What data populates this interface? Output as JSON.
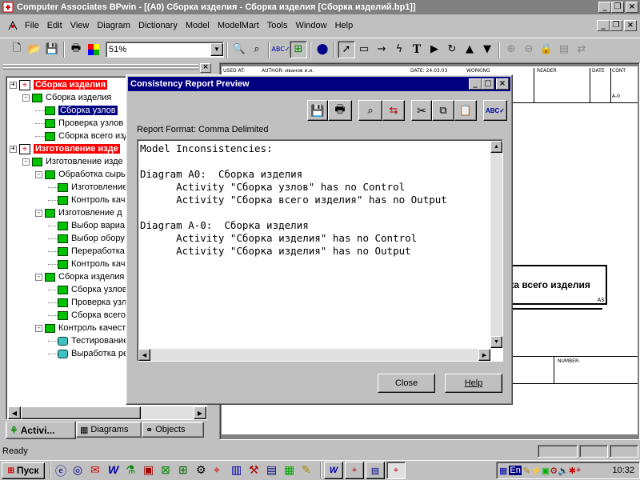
{
  "app": {
    "title": "Computer Associates BPwin - [(A0) Сборка изделия - Сборка изделия  [Сборка изделий.bp1]]"
  },
  "menu": [
    "File",
    "Edit",
    "View",
    "Diagram",
    "Dictionary",
    "Model",
    "ModelMart",
    "Tools",
    "Window",
    "Help"
  ],
  "toolbar": {
    "zoom": "51%"
  },
  "tree": {
    "items": [
      {
        "label": "Сборка изделия",
        "style": "red"
      },
      {
        "label": "Сборка изделия",
        "style": "normal"
      },
      {
        "label": "Сборка узлов",
        "style": "selected"
      },
      {
        "label": "Проверка узлов",
        "style": "normal"
      },
      {
        "label": "Сборка всего изд",
        "style": "normal"
      },
      {
        "label": "Изготовление изде",
        "style": "red"
      },
      {
        "label": "Изготовление изде",
        "style": "normal"
      },
      {
        "label": "Обработка сырь",
        "style": "normal"
      },
      {
        "label": "Изготовление",
        "style": "normal"
      },
      {
        "label": "Контроль кач",
        "style": "normal"
      },
      {
        "label": "Изготовление д",
        "style": "normal"
      },
      {
        "label": "Выбор вариа",
        "style": "normal"
      },
      {
        "label": "Выбор обору",
        "style": "normal"
      },
      {
        "label": "Переработка",
        "style": "normal"
      },
      {
        "label": "Контроль кач",
        "style": "normal"
      },
      {
        "label": "Сборка изделия",
        "style": "normal"
      },
      {
        "label": "Сборка узлов",
        "style": "normal"
      },
      {
        "label": "Проверка узл",
        "style": "normal"
      },
      {
        "label": "Сборка всего",
        "style": "normal"
      },
      {
        "label": "Контроль качест",
        "style": "normal"
      },
      {
        "label": "Тестирование",
        "style": "normal"
      },
      {
        "label": "Выработка ре",
        "style": "normal"
      }
    ],
    "tabs": [
      "Activi...",
      "Diagrams",
      "Objects"
    ]
  },
  "diagram": {
    "used_at": "USED AT:",
    "author": "AUTHOR: иванов и.и.",
    "date": "DATE: 24.03.03",
    "working": "WORKING",
    "reader": "READER",
    "date2": "DATE",
    "context": "CONT",
    "node_code": "A-0",
    "box_label": "рка всего изделия",
    "box_code": "A3",
    "number": "NUMBER:"
  },
  "dialog": {
    "title": "Consistency Report Preview",
    "format_label": "Report Format: Comma Delimited",
    "report_lines": [
      "Model Inconsistencies:",
      "",
      "Diagram A0:  Сборка изделия",
      "      Activity \"Сборка узлов\" has no Control",
      "      Activity \"Сборка всего изделия\" has no Output",
      "",
      "Diagram A-0:  Сборка изделия",
      "      Activity \"Сборка изделия\" has no Control",
      "      Activity \"Сборка изделия\" has no Output"
    ],
    "close_label": "Close",
    "help_label": "Help"
  },
  "status": {
    "text": "Ready"
  },
  "taskbar": {
    "start_label": "Пуск",
    "lang": "En",
    "time": "10:32"
  },
  "colors": {
    "titlebar": "#000080",
    "tree_red": "#ff0000",
    "activity_green": "#00c000"
  }
}
